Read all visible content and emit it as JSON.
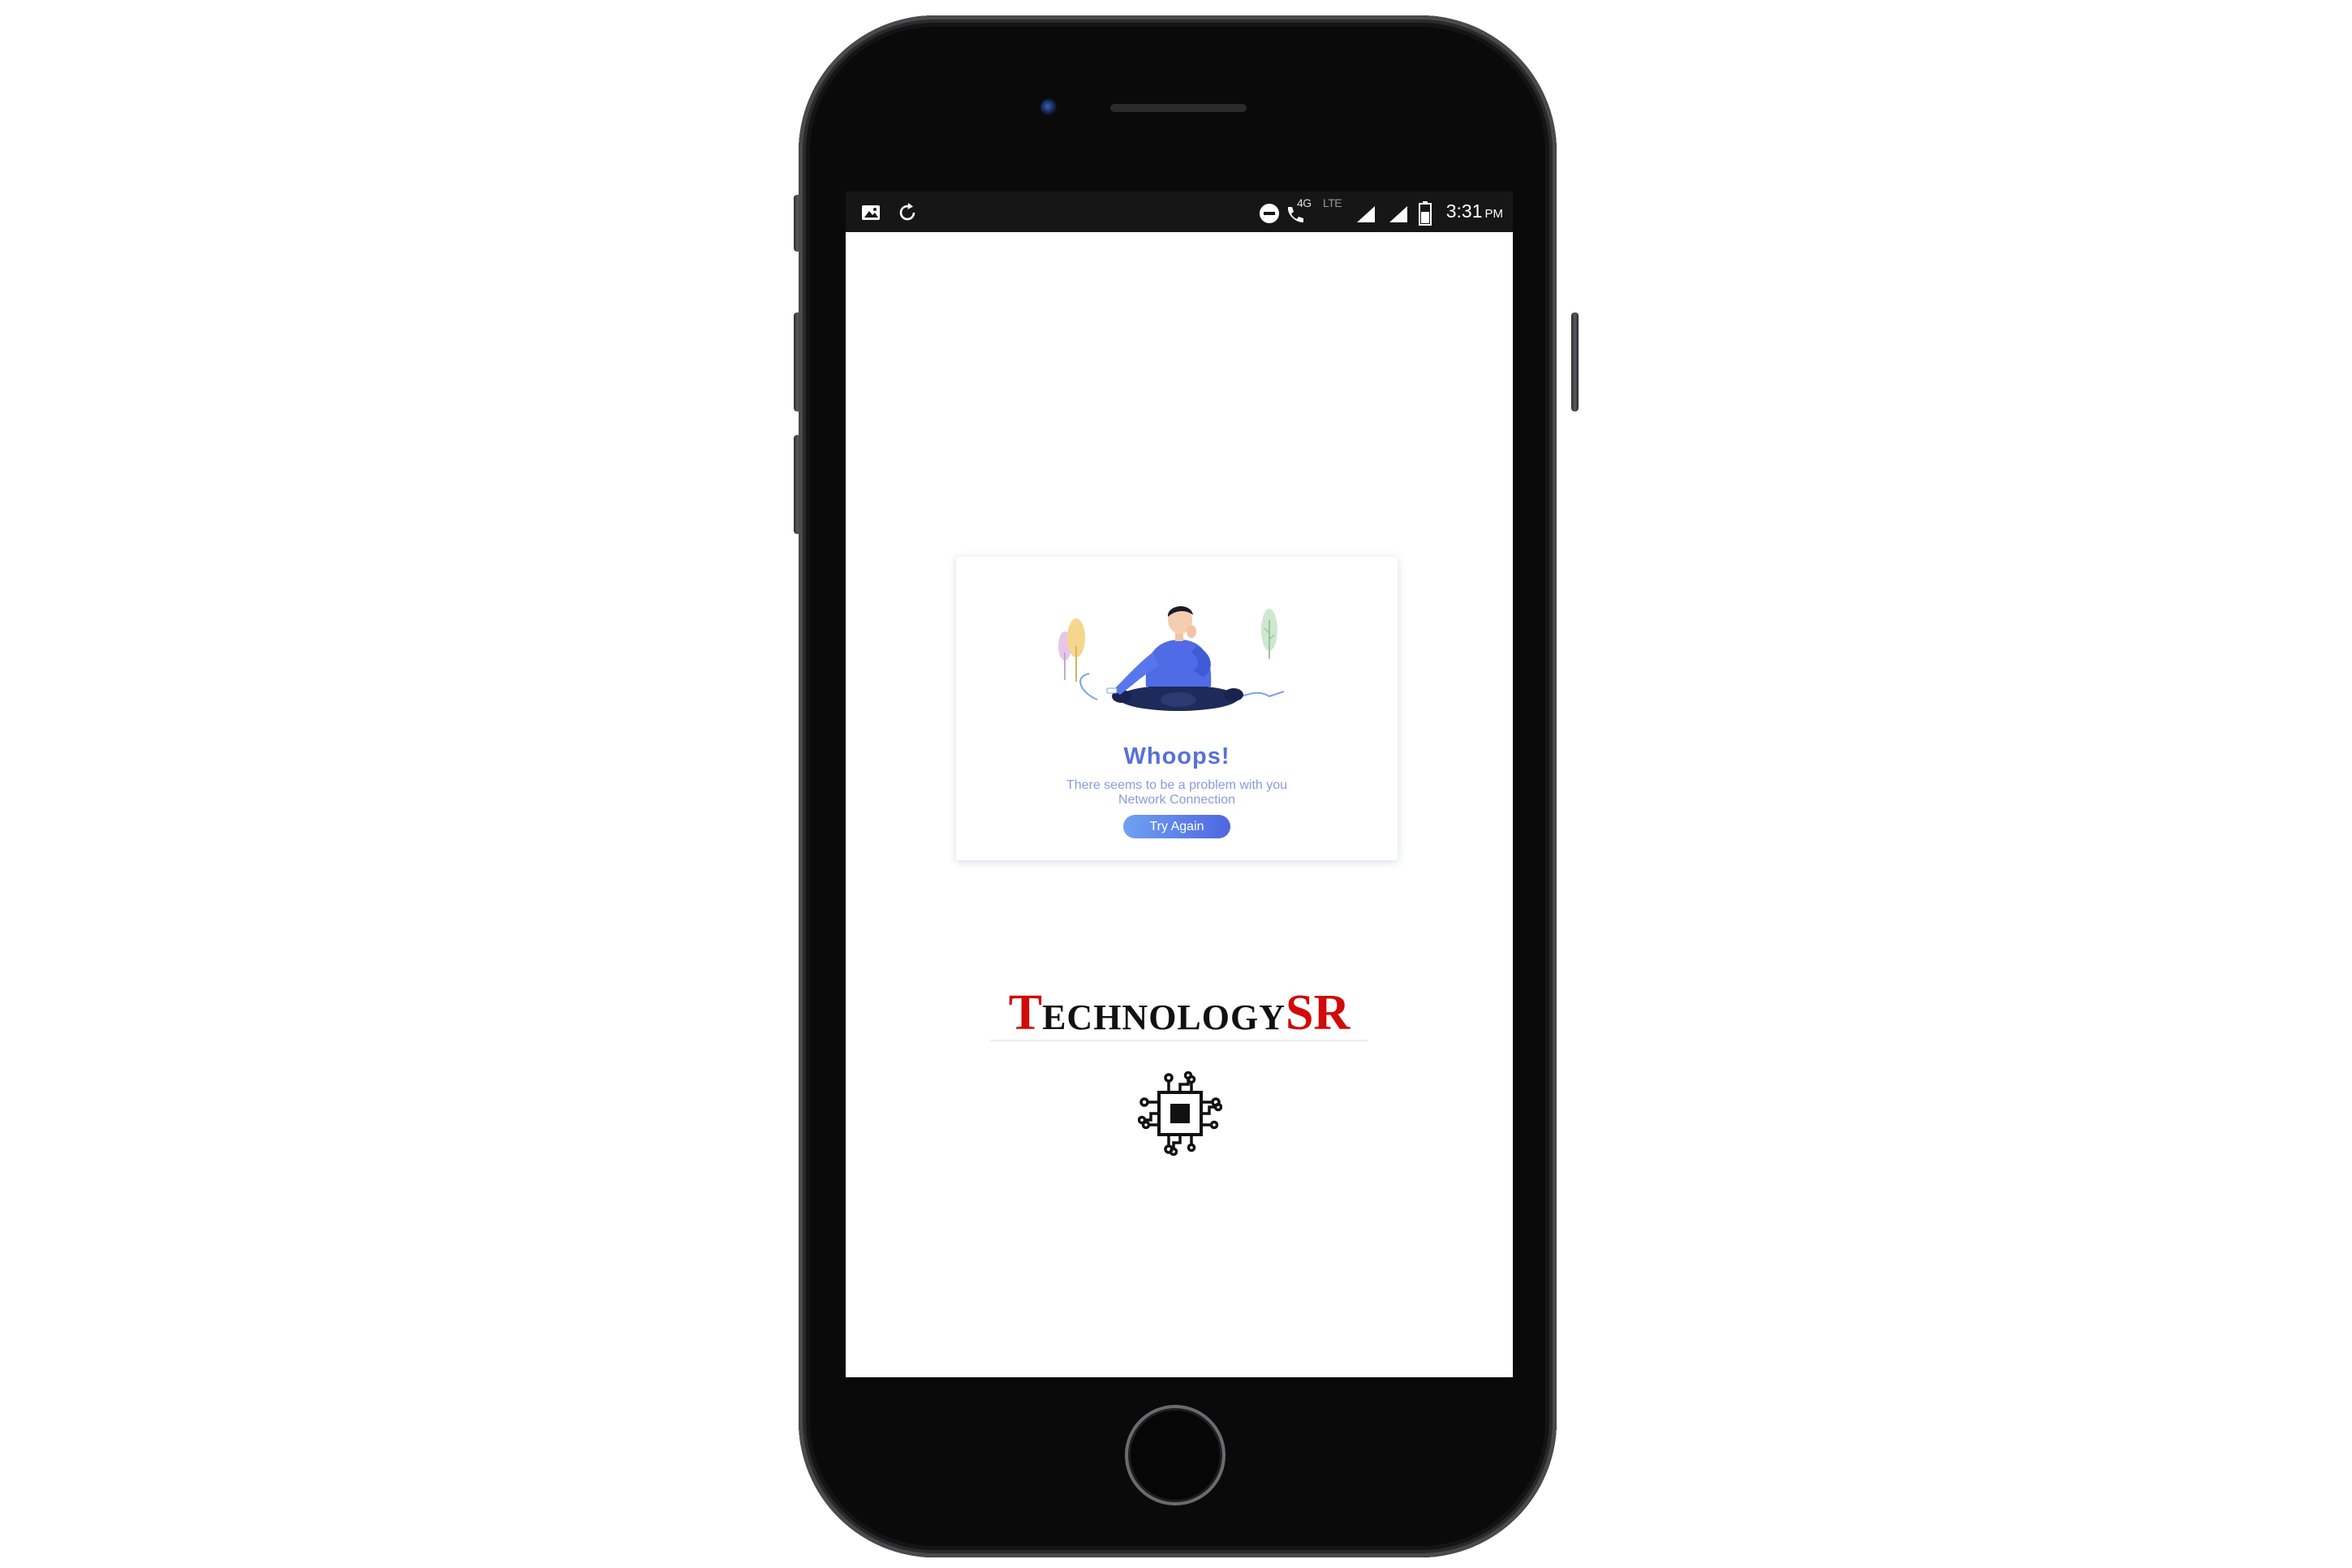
{
  "status_bar": {
    "left_icons": [
      "image-icon",
      "sync-icon"
    ],
    "right_icons": [
      "do-not-disturb-icon",
      "wifi-calling-icon",
      "signal-icon",
      "signal-icon",
      "battery-icon"
    ],
    "network_4g": "4G",
    "network_lte": "LTE",
    "time": "3:31",
    "ampm": "PM"
  },
  "error_card": {
    "title": "Whoops!",
    "message": "There seems to be a problem with you Network Connection",
    "button_label": "Try Again"
  },
  "brand": {
    "name": "TechnologySR",
    "logo_icon": "circuit-chip-icon"
  },
  "colors": {
    "accent": "#5870d8",
    "brand_red": "#d10a0a",
    "brand_black": "#111111",
    "status_bar": "#161616"
  }
}
